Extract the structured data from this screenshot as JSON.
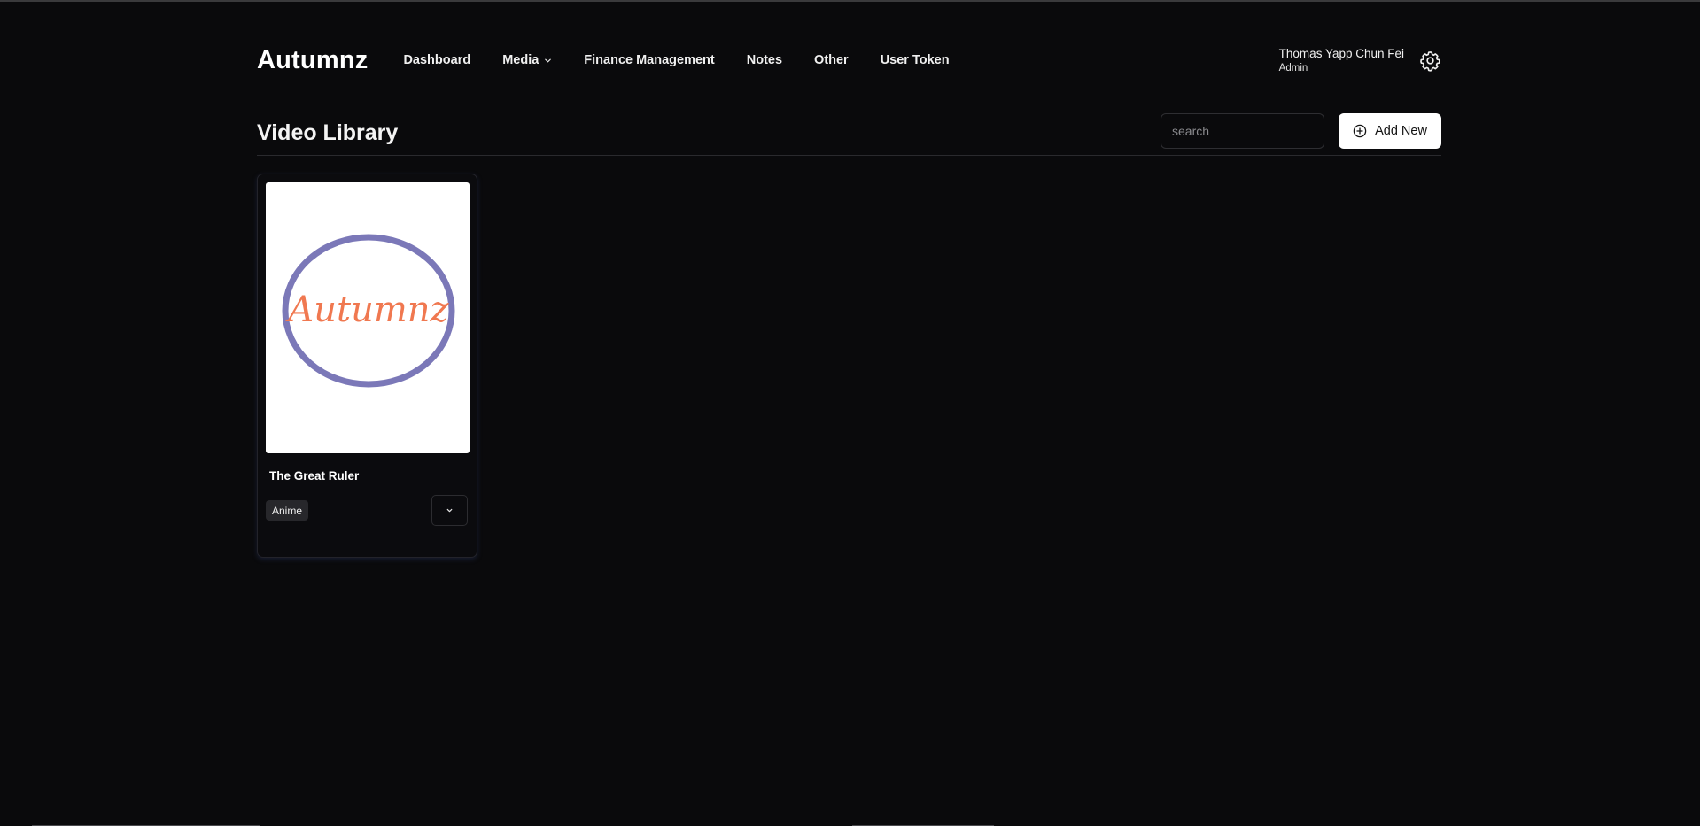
{
  "brand": "Autumnz",
  "nav": {
    "items": [
      {
        "label": "Dashboard"
      },
      {
        "label": "Media",
        "has_dropdown": true
      },
      {
        "label": "Finance Management"
      },
      {
        "label": "Notes"
      },
      {
        "label": "Other"
      },
      {
        "label": "User Token"
      }
    ]
  },
  "user": {
    "name": "Thomas Yapp Chun Fei",
    "role": "Admin",
    "settings_icon": "gear-icon"
  },
  "page": {
    "title": "Video Library",
    "search_placeholder": "search",
    "search_value": "",
    "add_button_label": "Add New",
    "add_button_icon": "plus-circle-icon"
  },
  "videos": [
    {
      "title": "The Great Ruler",
      "tag": "Anime",
      "thumbnail_text": "Autumnz",
      "menu_icon": "chevron-down-icon"
    }
  ],
  "colors": {
    "background": "#0a0a0c",
    "logo_ring": "#7b78b8",
    "logo_text": "#f07850"
  }
}
